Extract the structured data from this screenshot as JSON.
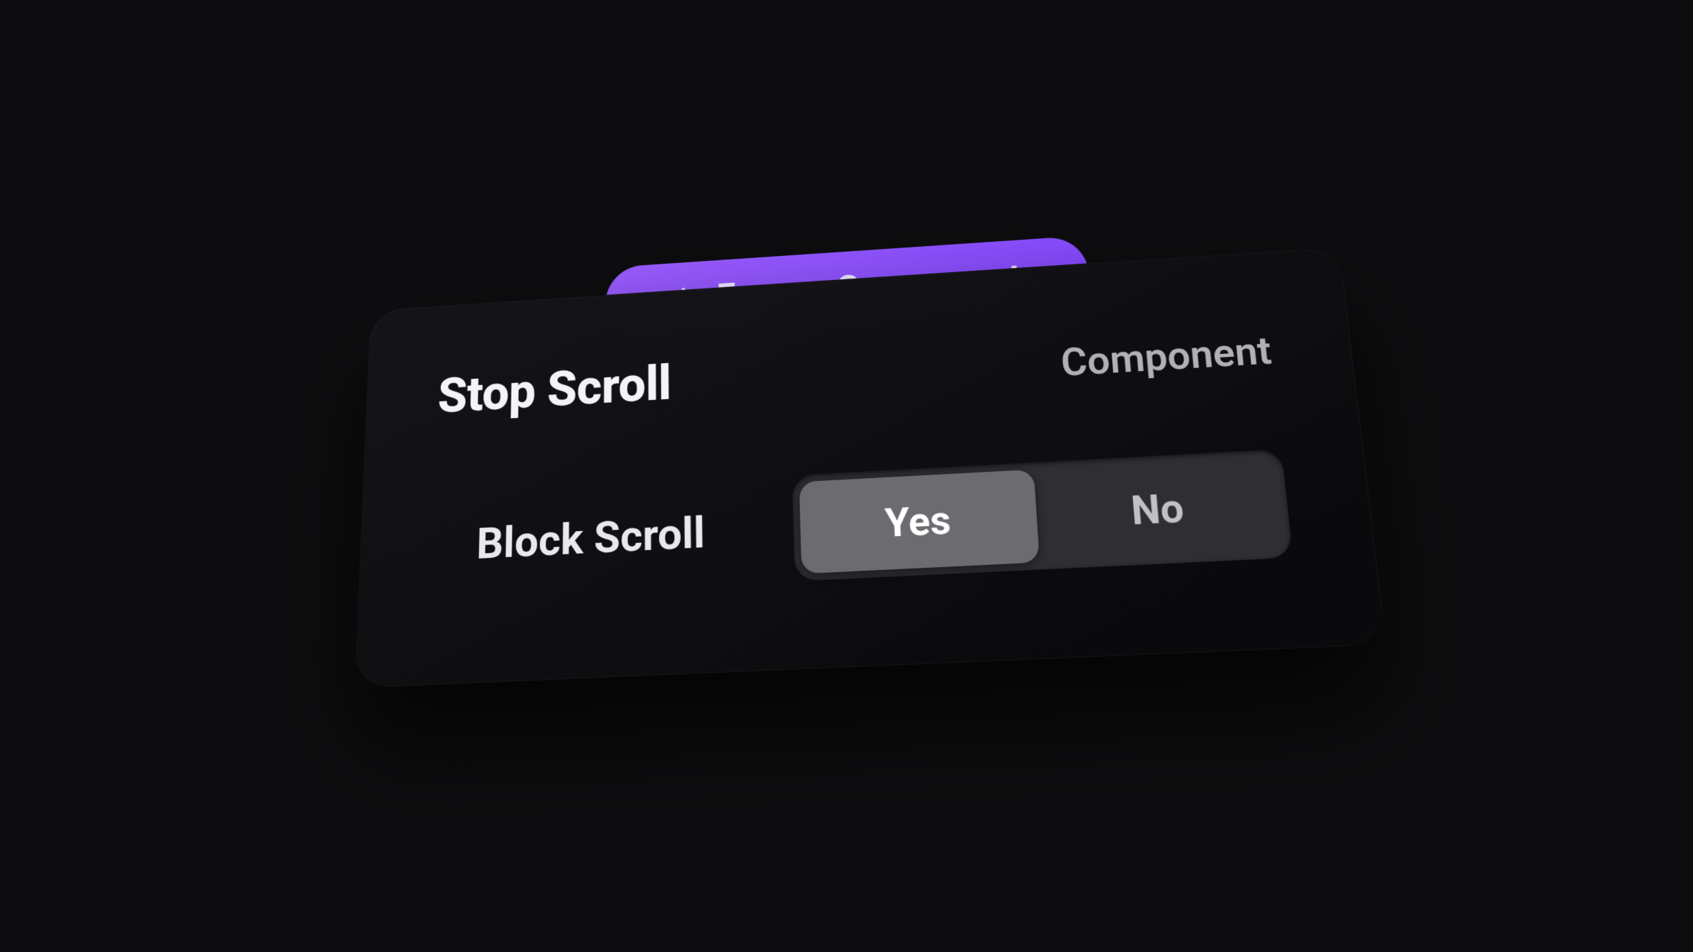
{
  "colors": {
    "accent": "#8A4FFF",
    "panel_bg": "#121214",
    "segment_bg": "#2F2F33",
    "segment_active": "#6B6B70"
  },
  "pill": {
    "icon_name": "framer-logo",
    "label": "Framer Component"
  },
  "panel": {
    "title": "Stop Scroll",
    "subtitle": "Component",
    "control": {
      "label": "Block Scroll",
      "options": {
        "yes": "Yes",
        "no": "No"
      },
      "selected": "yes"
    }
  }
}
